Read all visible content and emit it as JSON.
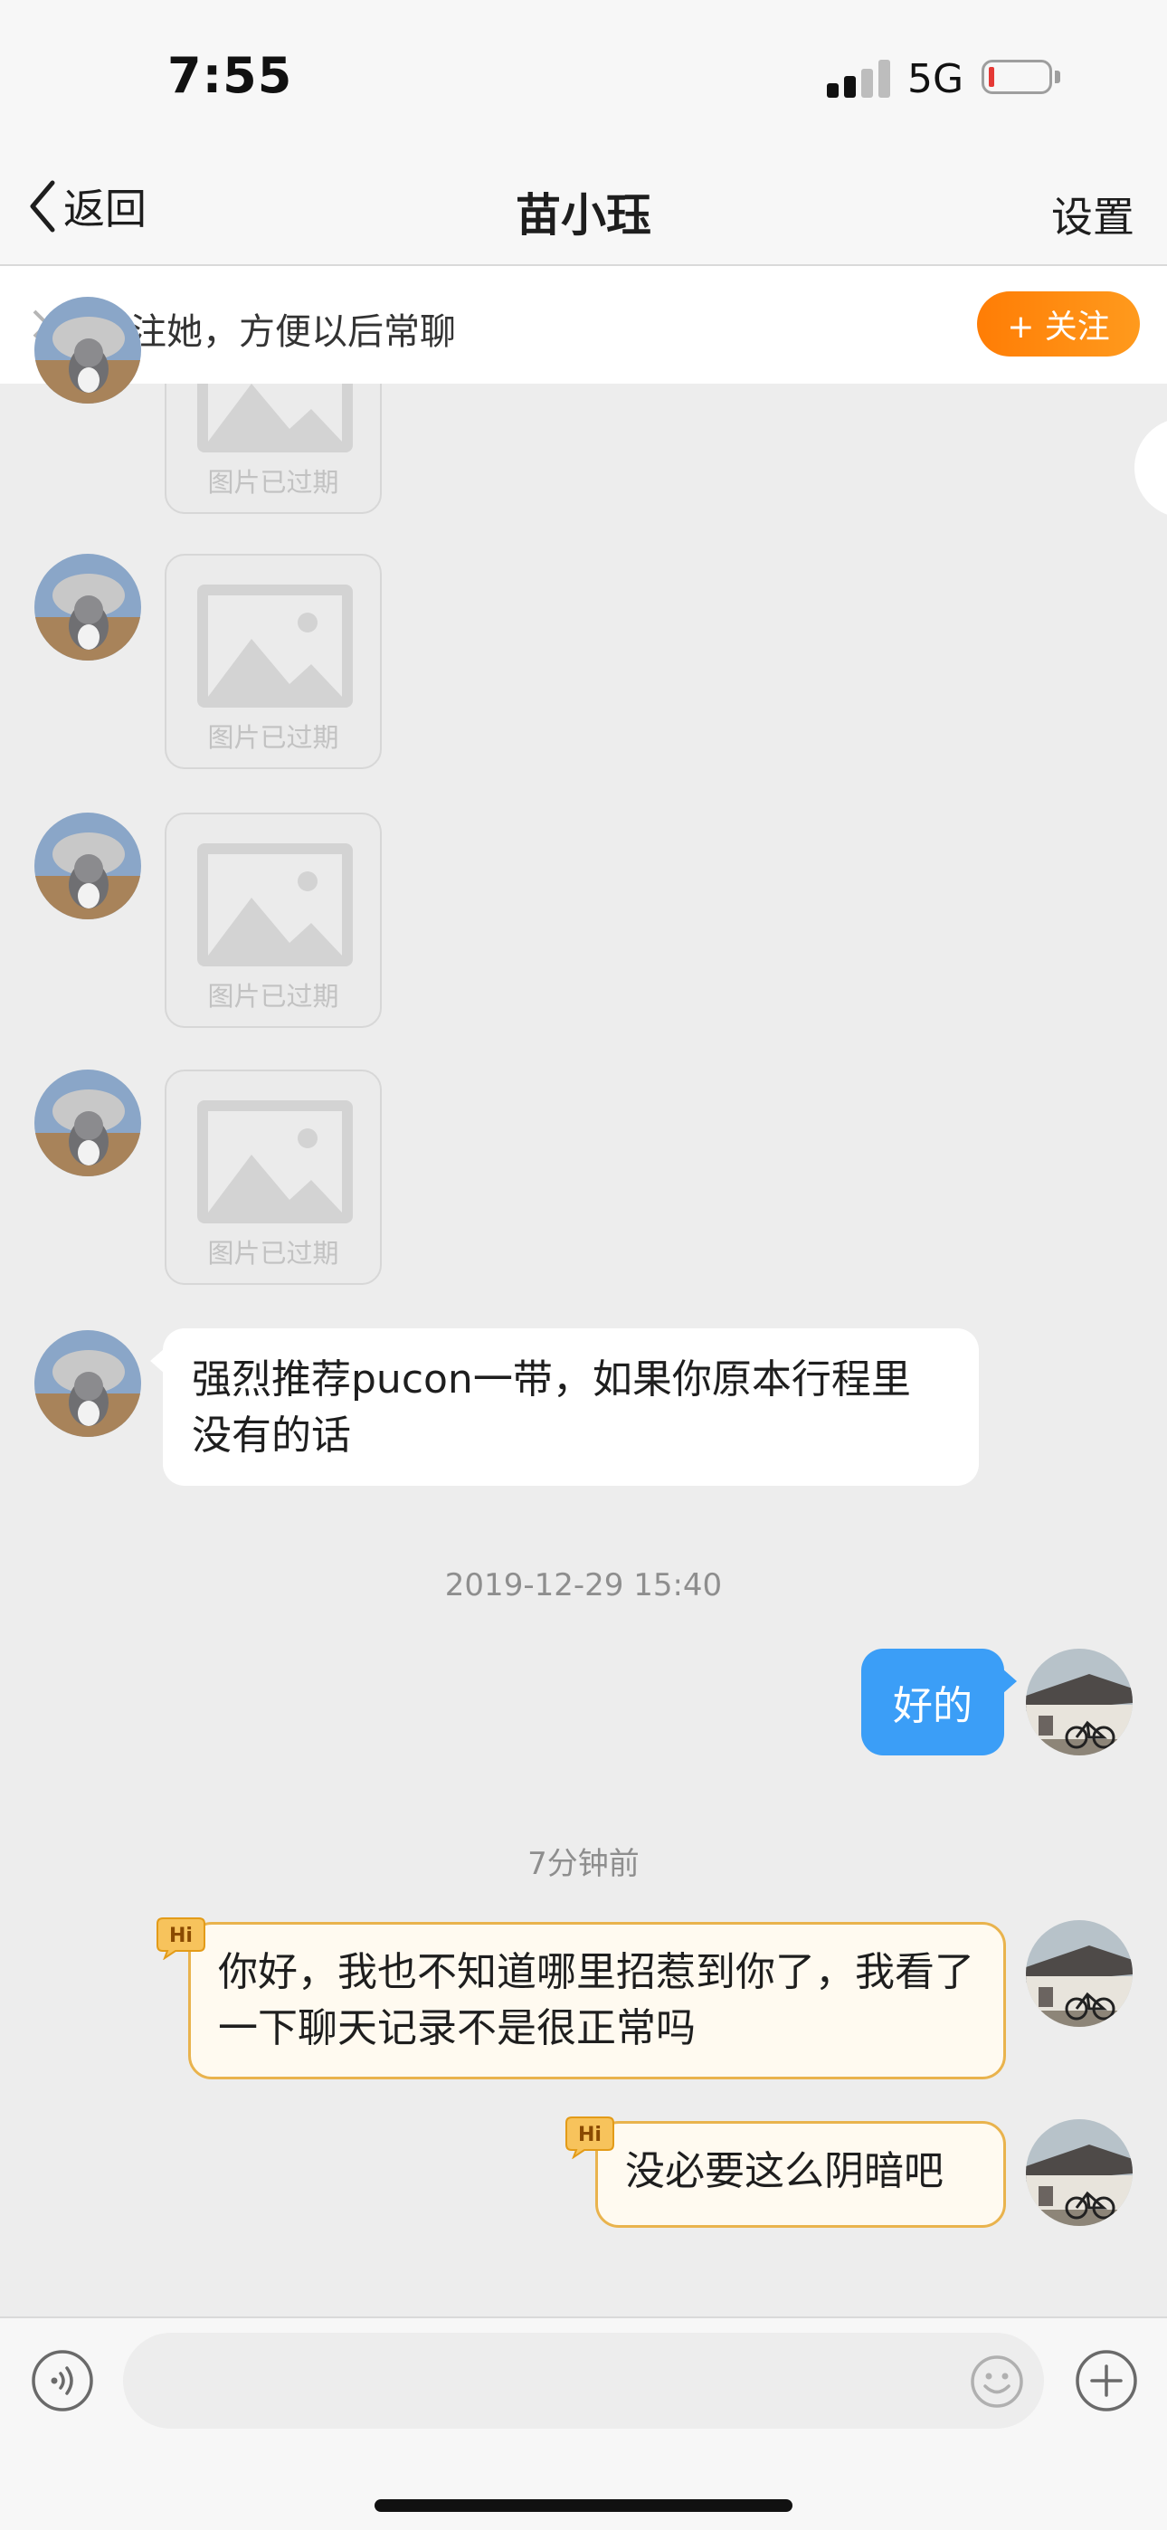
{
  "status_bar": {
    "time": "7:55",
    "network": "5G",
    "signal_bars_active": 2,
    "signal_bars_total": 4,
    "battery_level": 0.08
  },
  "nav": {
    "back_label": "返回",
    "title": "苗小珏",
    "settings_label": "设置"
  },
  "follow_banner": {
    "text": "关注她，方便以后常聊",
    "button_label": "+ 关注"
  },
  "messages": {
    "expired_label": "图片已过期",
    "received_text": "强烈推荐pucon一带，如果你原本行程里没有的话",
    "timestamp_1": "2019-12-29 15:40",
    "sent_1": "好的",
    "timestamp_2": "7分钟前",
    "sent_hi_1": "你好，我也不知道哪里招惹到你了，我看了一下聊天记录不是很正常吗",
    "sent_hi_2": "没必要这么阴暗吧",
    "hi_badge": "Hi"
  },
  "input": {
    "placeholder": ""
  },
  "colors": {
    "accent_orange": "#ff8a10",
    "sent_bubble": "#3b9ef7",
    "hi_border": "#e9b34d",
    "background": "#ededed"
  }
}
